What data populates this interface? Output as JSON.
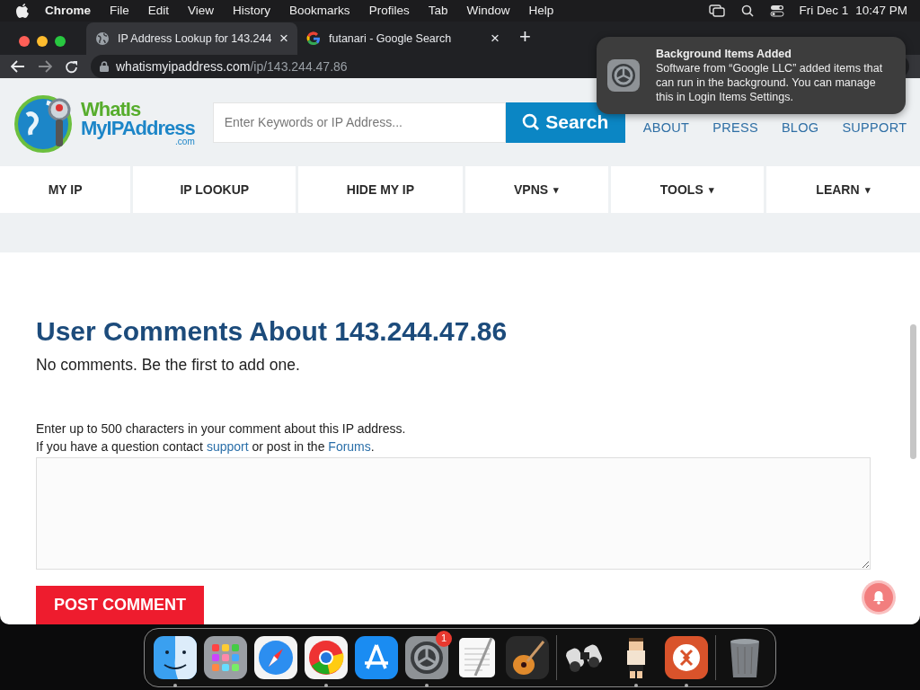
{
  "menu_bar": {
    "app": "Chrome",
    "menus": [
      "File",
      "Edit",
      "View",
      "History",
      "Bookmarks",
      "Profiles",
      "Tab",
      "Window",
      "Help"
    ],
    "date": "Fri Dec 1",
    "time": "10:47 PM"
  },
  "tabs": [
    {
      "title": "IP Address Lookup for 143.244",
      "kind": "globe",
      "selected": true,
      "close": "×"
    },
    {
      "title": "futanari - Google Search",
      "kind": "google",
      "selected": false,
      "close": "×"
    }
  ],
  "new_tab": "+",
  "address_bar": {
    "domain": "whatismyipaddress.com",
    "path": "/ip/143.244.47.86"
  },
  "notification": {
    "title": "Background Items Added",
    "body": "Software from “Google LLC” added items that can run in the background. You can manage this in Login Items Settings."
  },
  "site": {
    "logo": {
      "line1": "WhatIs",
      "line2": "MyIPAddress",
      "line3": ".com"
    },
    "search": {
      "placeholder": "Enter Keywords or IP Address...",
      "button": "Search"
    },
    "top_links": [
      "ABOUT",
      "PRESS",
      "BLOG",
      "SUPPORT"
    ],
    "nav": [
      {
        "label": "MY IP"
      },
      {
        "label": "IP LOOKUP"
      },
      {
        "label": "HIDE MY IP"
      },
      {
        "label": "VPNS",
        "caret": "▾"
      },
      {
        "label": "TOOLS",
        "caret": "▾"
      },
      {
        "label": "LEARN",
        "caret": "▾"
      }
    ]
  },
  "comments": {
    "heading": "User Comments About 143.244.47.86",
    "empty_text": "No comments. Be the first to add one.",
    "instructions": "Enter up to 500 characters in your comment about this IP address.",
    "help": [
      {
        "kind": "text",
        "text": "If you have a question contact "
      },
      {
        "kind": "link",
        "text": "support"
      },
      {
        "kind": "text",
        "text": " or post in the "
      },
      {
        "kind": "link",
        "text": "Forums"
      },
      {
        "kind": "text",
        "text": "."
      }
    ],
    "button": "POST COMMENT"
  },
  "dock": [
    {
      "kind": "finder",
      "running": true
    },
    {
      "kind": "launchpad",
      "running": false
    },
    {
      "kind": "safari",
      "running": false
    },
    {
      "kind": "chrome",
      "running": true
    },
    {
      "kind": "appstore",
      "running": false
    },
    {
      "kind": "settings",
      "running": true,
      "badge": "1"
    },
    {
      "kind": "textedit",
      "running": false
    },
    {
      "kind": "guitar",
      "running": false
    },
    {
      "kind": "separator"
    },
    {
      "kind": "binoculars",
      "running": false
    },
    {
      "kind": "figure",
      "running": true
    },
    {
      "kind": "remote",
      "running": true
    },
    {
      "kind": "separator"
    },
    {
      "kind": "trash",
      "running": false
    }
  ]
}
